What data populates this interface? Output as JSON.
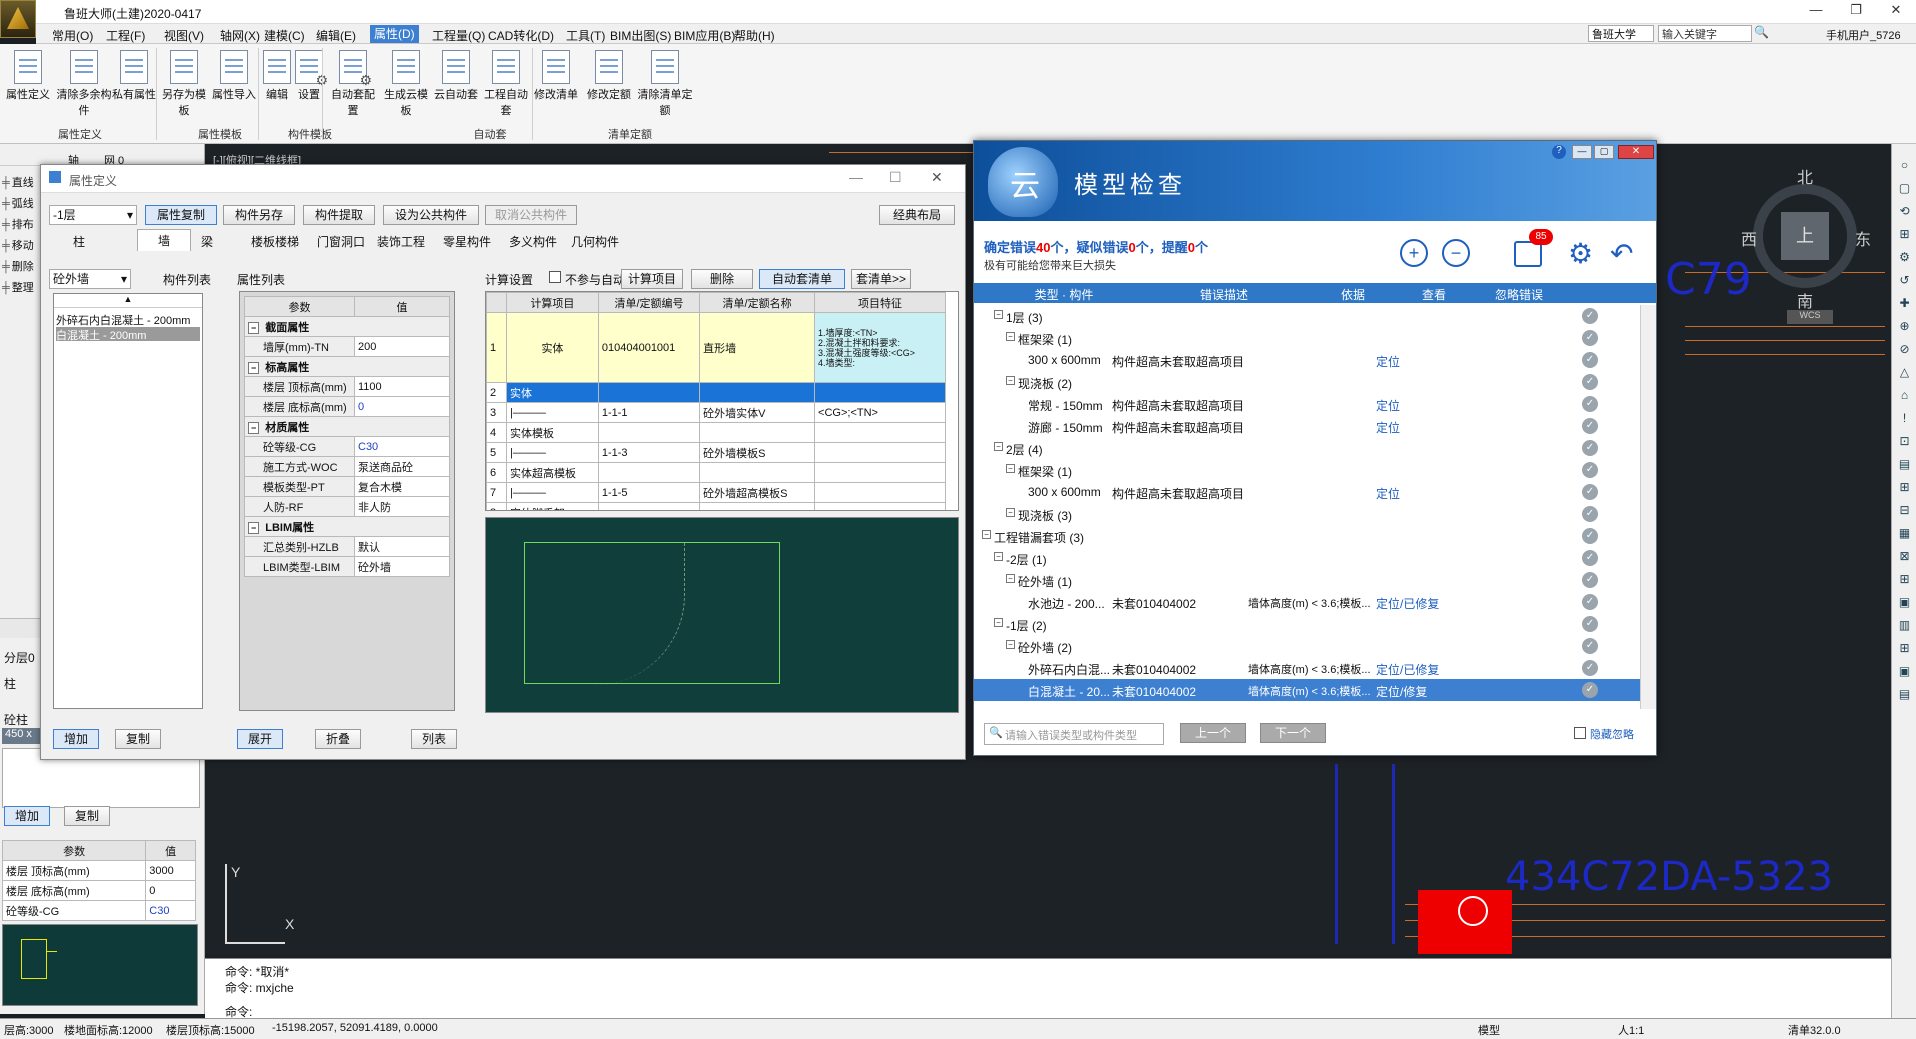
{
  "app": {
    "title": "鲁班大师(土建)2020-0417"
  },
  "menu": [
    "常用(O)",
    "工程(F)",
    "视图(V)",
    "轴网(X)",
    "建模(C)",
    "编辑(E)",
    "属性(D)",
    "工程量(Q)",
    "CAD转化(D)",
    "工具(T)",
    "BIM出图(S)",
    "BIM应用(B)",
    "帮助(H)"
  ],
  "search": {
    "scope": "鲁班大学",
    "placeholder": "输入关键字",
    "user": "手机用户_5726"
  },
  "ribbon": {
    "buttons": [
      "属性定义",
      "清除多余构件",
      "私有属性",
      "另存为模板",
      "属性导入",
      "编辑",
      "设置",
      "自动套配置",
      "生成云模板",
      "云自动套",
      "工程自动套",
      "修改清单",
      "修改定额",
      "清除清单定额"
    ],
    "groups": [
      "属性定义",
      "属性模板",
      "构件模板",
      "自动套",
      "清单定额"
    ]
  },
  "left_panel": {
    "top_label": "轴",
    "mid_label": "网 0",
    "tools": [
      "直线",
      "弧线",
      "排布",
      "移动",
      "删除",
      "整理"
    ],
    "floor": "分层0",
    "col": "柱",
    "concrete_col": "砼柱",
    "size": "450 x",
    "add": "增加",
    "copy": "复制",
    "param_head": [
      "参数",
      "值"
    ],
    "params": [
      [
        "楼层 顶标高(mm)",
        "3000"
      ],
      [
        "楼层 底标高(mm)",
        "0"
      ],
      [
        "砼等级-CG",
        "C30"
      ]
    ]
  },
  "prop_dialog": {
    "title": "属性定义",
    "floor": "-1层",
    "btns": [
      "属性复制",
      "构件另存",
      "构件提取",
      "设为公共构件",
      "取消公共构件",
      "经典布局"
    ],
    "tabs": [
      "柱",
      "墙",
      "梁",
      "楼板楼梯",
      "门窗洞口",
      "装饰工程",
      "零星构件",
      "多义构件",
      "几何构件"
    ],
    "type_select": "砼外墙",
    "list_title": "构件列表",
    "components": [
      "外碎石内白混凝土 - 200mm",
      "白混凝土 - 200mm"
    ],
    "prop_title": "属性列表",
    "prop_head": [
      "参数",
      "值"
    ],
    "props": [
      {
        "group": true,
        "name": "截面属性"
      },
      {
        "name": "墙厚(mm)-TN",
        "value": "200"
      },
      {
        "group": true,
        "name": "标高属性"
      },
      {
        "name": "楼层 顶标高(mm)",
        "value": "1100"
      },
      {
        "name": "楼层 底标高(mm)",
        "value": "0"
      },
      {
        "group": true,
        "name": "材质属性"
      },
      {
        "name": "砼等级-CG",
        "value": "C30"
      },
      {
        "name": "施工方式-WOC",
        "value": "泵送商品砼"
      },
      {
        "name": "模板类型-PT",
        "value": "复合木模"
      },
      {
        "name": "人防-RF",
        "value": "非人防"
      },
      {
        "group": true,
        "name": "LBIM属性"
      },
      {
        "name": "汇总类别-HZLB",
        "value": "默认"
      },
      {
        "name": "LBIM类型-LBIM",
        "value": "砼外墙"
      }
    ],
    "calc_title": "计算设置",
    "no_auto": "不参与自动套",
    "calc_btns": [
      "计算项目",
      "删除",
      "自动套清单",
      "套清单>>"
    ],
    "calc_head": [
      "计算项目",
      "清单/定额编号",
      "清单/定额名称",
      "项目特征"
    ],
    "calc_rows": [
      [
        "1",
        "实体",
        "010404001001",
        "直形墙",
        "1.墙厚度:<TN>\n2.混凝土拌和料要求:\n3.混凝土强度等级:<CG>\n4.墙类型:"
      ],
      [
        "2",
        "实体",
        "",
        "",
        ""
      ],
      [
        "3",
        "|———",
        "1-1-1",
        "砼外墙实体V",
        "<CG>;<TN>"
      ],
      [
        "4",
        "实体模板",
        "",
        "",
        ""
      ],
      [
        "5",
        "|———",
        "1-1-3",
        "砼外墙模板S",
        ""
      ],
      [
        "6",
        "实体超高模板",
        "",
        "",
        ""
      ],
      [
        "7",
        "|———",
        "1-1-5",
        "砼外墙超高模板S",
        ""
      ],
      [
        "8",
        "实体脚手架",
        "",
        "",
        ""
      ]
    ],
    "bottom_btns": [
      "增加",
      "复制",
      "展开",
      "折叠",
      "列表"
    ]
  },
  "model_check": {
    "title_cloud": "云",
    "title": "模型检查",
    "summary_pre": "确定错误",
    "errors": "40",
    "summary_mid1": "个，疑似错误",
    "suspect": "0",
    "summary_mid2": "个，提醒",
    "reminders": "0",
    "summary_post": "个",
    "subtitle": "极有可能给您带来巨大损失",
    "badge": "85",
    "head": [
      "类型 · 构件",
      "错误描述",
      "依据",
      "查看",
      "忽略错误"
    ],
    "rows": [
      {
        "indent": 3,
        "label": "1层 (3)",
        "desc": "",
        "basis": "",
        "view": ""
      },
      {
        "indent": 4,
        "label": "框架梁 (1)",
        "desc": "",
        "basis": "",
        "view": ""
      },
      {
        "indent": 5,
        "label": "300 x 600mm",
        "desc": "构件超高未套取超高项目",
        "basis": "",
        "view": "定位"
      },
      {
        "indent": 4,
        "label": "现浇板 (2)",
        "desc": "",
        "basis": "",
        "view": ""
      },
      {
        "indent": 5,
        "label": "常规 - 150mm",
        "desc": "构件超高未套取超高项目",
        "basis": "",
        "view": "定位"
      },
      {
        "indent": 5,
        "label": "游廊 - 150mm",
        "desc": "构件超高未套取超高项目",
        "basis": "",
        "view": "定位"
      },
      {
        "indent": 3,
        "label": "2层 (4)",
        "desc": "",
        "basis": "",
        "view": ""
      },
      {
        "indent": 4,
        "label": "框架梁 (1)",
        "desc": "",
        "basis": "",
        "view": ""
      },
      {
        "indent": 5,
        "label": "300 x 600mm",
        "desc": "构件超高未套取超高项目",
        "basis": "",
        "view": "定位"
      },
      {
        "indent": 4,
        "label": "现浇板 (3)",
        "desc": "",
        "basis": "",
        "view": ""
      },
      {
        "indent": 2,
        "label": "工程错漏套项 (3)",
        "desc": "",
        "basis": "",
        "view": ""
      },
      {
        "indent": 3,
        "label": "-2层 (1)",
        "desc": "",
        "basis": "",
        "view": ""
      },
      {
        "indent": 4,
        "label": "砼外墙 (1)",
        "desc": "",
        "basis": "",
        "view": ""
      },
      {
        "indent": 5,
        "label": "水池边 - 200...",
        "desc": "未套010404002",
        "basis": "墙体高度(m) < 3.6;模板...",
        "view": "定位/已修复"
      },
      {
        "indent": 3,
        "label": "-1层 (2)",
        "desc": "",
        "basis": "",
        "view": ""
      },
      {
        "indent": 4,
        "label": "砼外墙 (2)",
        "desc": "",
        "basis": "",
        "view": ""
      },
      {
        "indent": 5,
        "label": "外碎石内白混...",
        "desc": "未套010404002",
        "basis": "墙体高度(m) < 3.6;模板...",
        "view": "定位/已修复"
      },
      {
        "indent": 5,
        "label": "白混凝土 - 20...",
        "desc": "未套010404002",
        "basis": "墙体高度(m) < 3.6;模板...",
        "view": "定位/修复",
        "selected": true
      }
    ],
    "search_placeholder": "请输入错误类型或构件类型",
    "prev": "上一个",
    "next": "下一个",
    "hide_ignored": "隐藏忽略"
  },
  "canvas": {
    "tab": "[-][俯视][二维线框]",
    "compass": {
      "n": "北",
      "s": "南",
      "e": "东",
      "w": "西",
      "center": "上",
      "wcs": "WCS"
    },
    "text1": "C79",
    "text2": "434C72DA-5323",
    "axis_y": "Y",
    "axis_x": "X"
  },
  "cmd": {
    "lines": [
      "命令: *取消*",
      "命令: mxjche"
    ],
    "prompt": "命令:"
  },
  "status": {
    "floor_h": "层高:3000",
    "floor_base": "楼地面标高:12000",
    "floor_top": "楼层顶标高:15000",
    "coords": "-15198.2057, 52091.4189, 0.0000",
    "mode": "模型",
    "scale": "人1:1",
    "clear": "清单32.0.0"
  }
}
